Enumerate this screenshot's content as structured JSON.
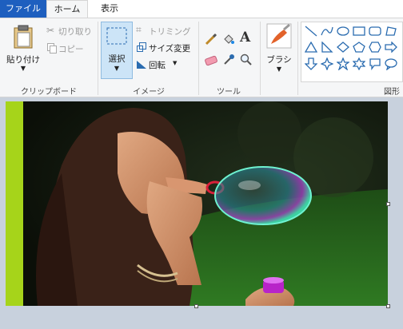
{
  "tabs": {
    "file": "ファイル",
    "home": "ホーム",
    "view": "表示"
  },
  "clipboard": {
    "paste": "貼り付け",
    "cut": "切り取り",
    "copy": "コピー",
    "group": "クリップボード"
  },
  "image": {
    "select": "選択",
    "crop": "トリミング",
    "resize": "サイズ変更",
    "rotate": "回転",
    "group": "イメージ"
  },
  "tools": {
    "group": "ツール"
  },
  "brushes": {
    "label": "ブラシ"
  },
  "shapes": {
    "group": "図形"
  },
  "colors": {
    "tab_active": "#1e5fbf",
    "select_highlight": "#cce4f7",
    "canvas_bg": "#c8d1dd",
    "lime_strip": "#a6d41a"
  }
}
